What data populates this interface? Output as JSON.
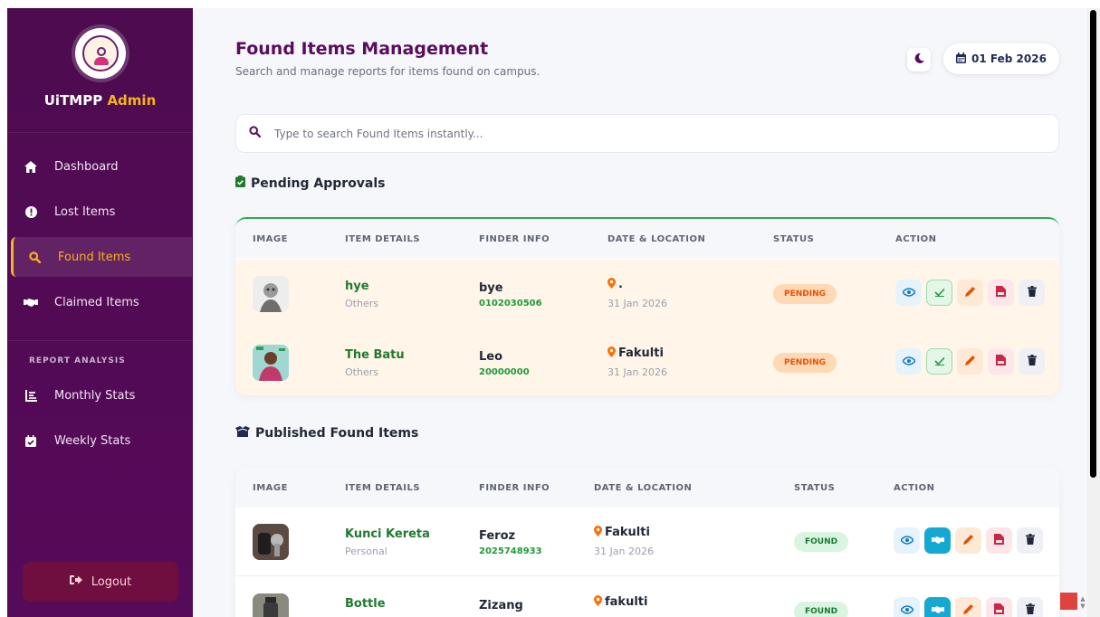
{
  "sidebar": {
    "brand_prefix": "UiTMPP",
    "brand_accent": "Admin",
    "logo_icon": "lost-and-found-logo",
    "items": [
      {
        "label": "Dashboard",
        "icon": "home-icon"
      },
      {
        "label": "Lost Items",
        "icon": "exclamation-icon"
      },
      {
        "label": "Found Items",
        "icon": "search-icon",
        "active": true
      },
      {
        "label": "Claimed Items",
        "icon": "handshake-icon"
      }
    ],
    "section_label": "REPORT ANALYSIS",
    "report_items": [
      {
        "label": "Monthly Stats",
        "icon": "chart-icon"
      },
      {
        "label": "Weekly Stats",
        "icon": "calendar-check-icon"
      }
    ],
    "logout_label": "Logout"
  },
  "header": {
    "title": "Found Items Management",
    "subtitle": "Search and manage reports for items found on campus.",
    "date": "01 Feb 2026"
  },
  "search": {
    "placeholder": "Type to search Found Items instantly..."
  },
  "pending": {
    "heading": "Pending Approvals",
    "columns": [
      "IMAGE",
      "ITEM DETAILS",
      "FINDER INFO",
      "DATE & LOCATION",
      "STATUS",
      "ACTION"
    ],
    "rows": [
      {
        "name": "hye",
        "category": "Others",
        "finder": "bye",
        "phone": "0102030506",
        "location": ".",
        "date": "31 Jan 2026",
        "status": "PENDING"
      },
      {
        "name": "The Batu",
        "category": "Others",
        "finder": "Leo",
        "phone": "20000000",
        "location": "Fakulti",
        "date": "31 Jan 2026",
        "status": "PENDING"
      }
    ]
  },
  "published": {
    "heading": "Published Found Items",
    "columns": [
      "IMAGE",
      "ITEM DETAILS",
      "FINDER INFO",
      "DATE & LOCATION",
      "STATUS",
      "ACTION"
    ],
    "rows": [
      {
        "name": "Kunci Kereta",
        "category": "Personal",
        "finder": "Feroz",
        "phone": "2025748933",
        "location": "Fakulti",
        "date": "31 Jan 2026",
        "status": "FOUND"
      },
      {
        "name": "Bottle",
        "category": "",
        "finder": "Zizang",
        "phone": "",
        "location": "fakulti",
        "date": "",
        "status": "FOUND"
      }
    ]
  },
  "colors": {
    "sidebar_bg": "#4e0b4f",
    "accent": "#f6b21b",
    "title": "#5a0c5e",
    "pending_row": "#fff5e8",
    "found_green": "#1f7a2e"
  }
}
